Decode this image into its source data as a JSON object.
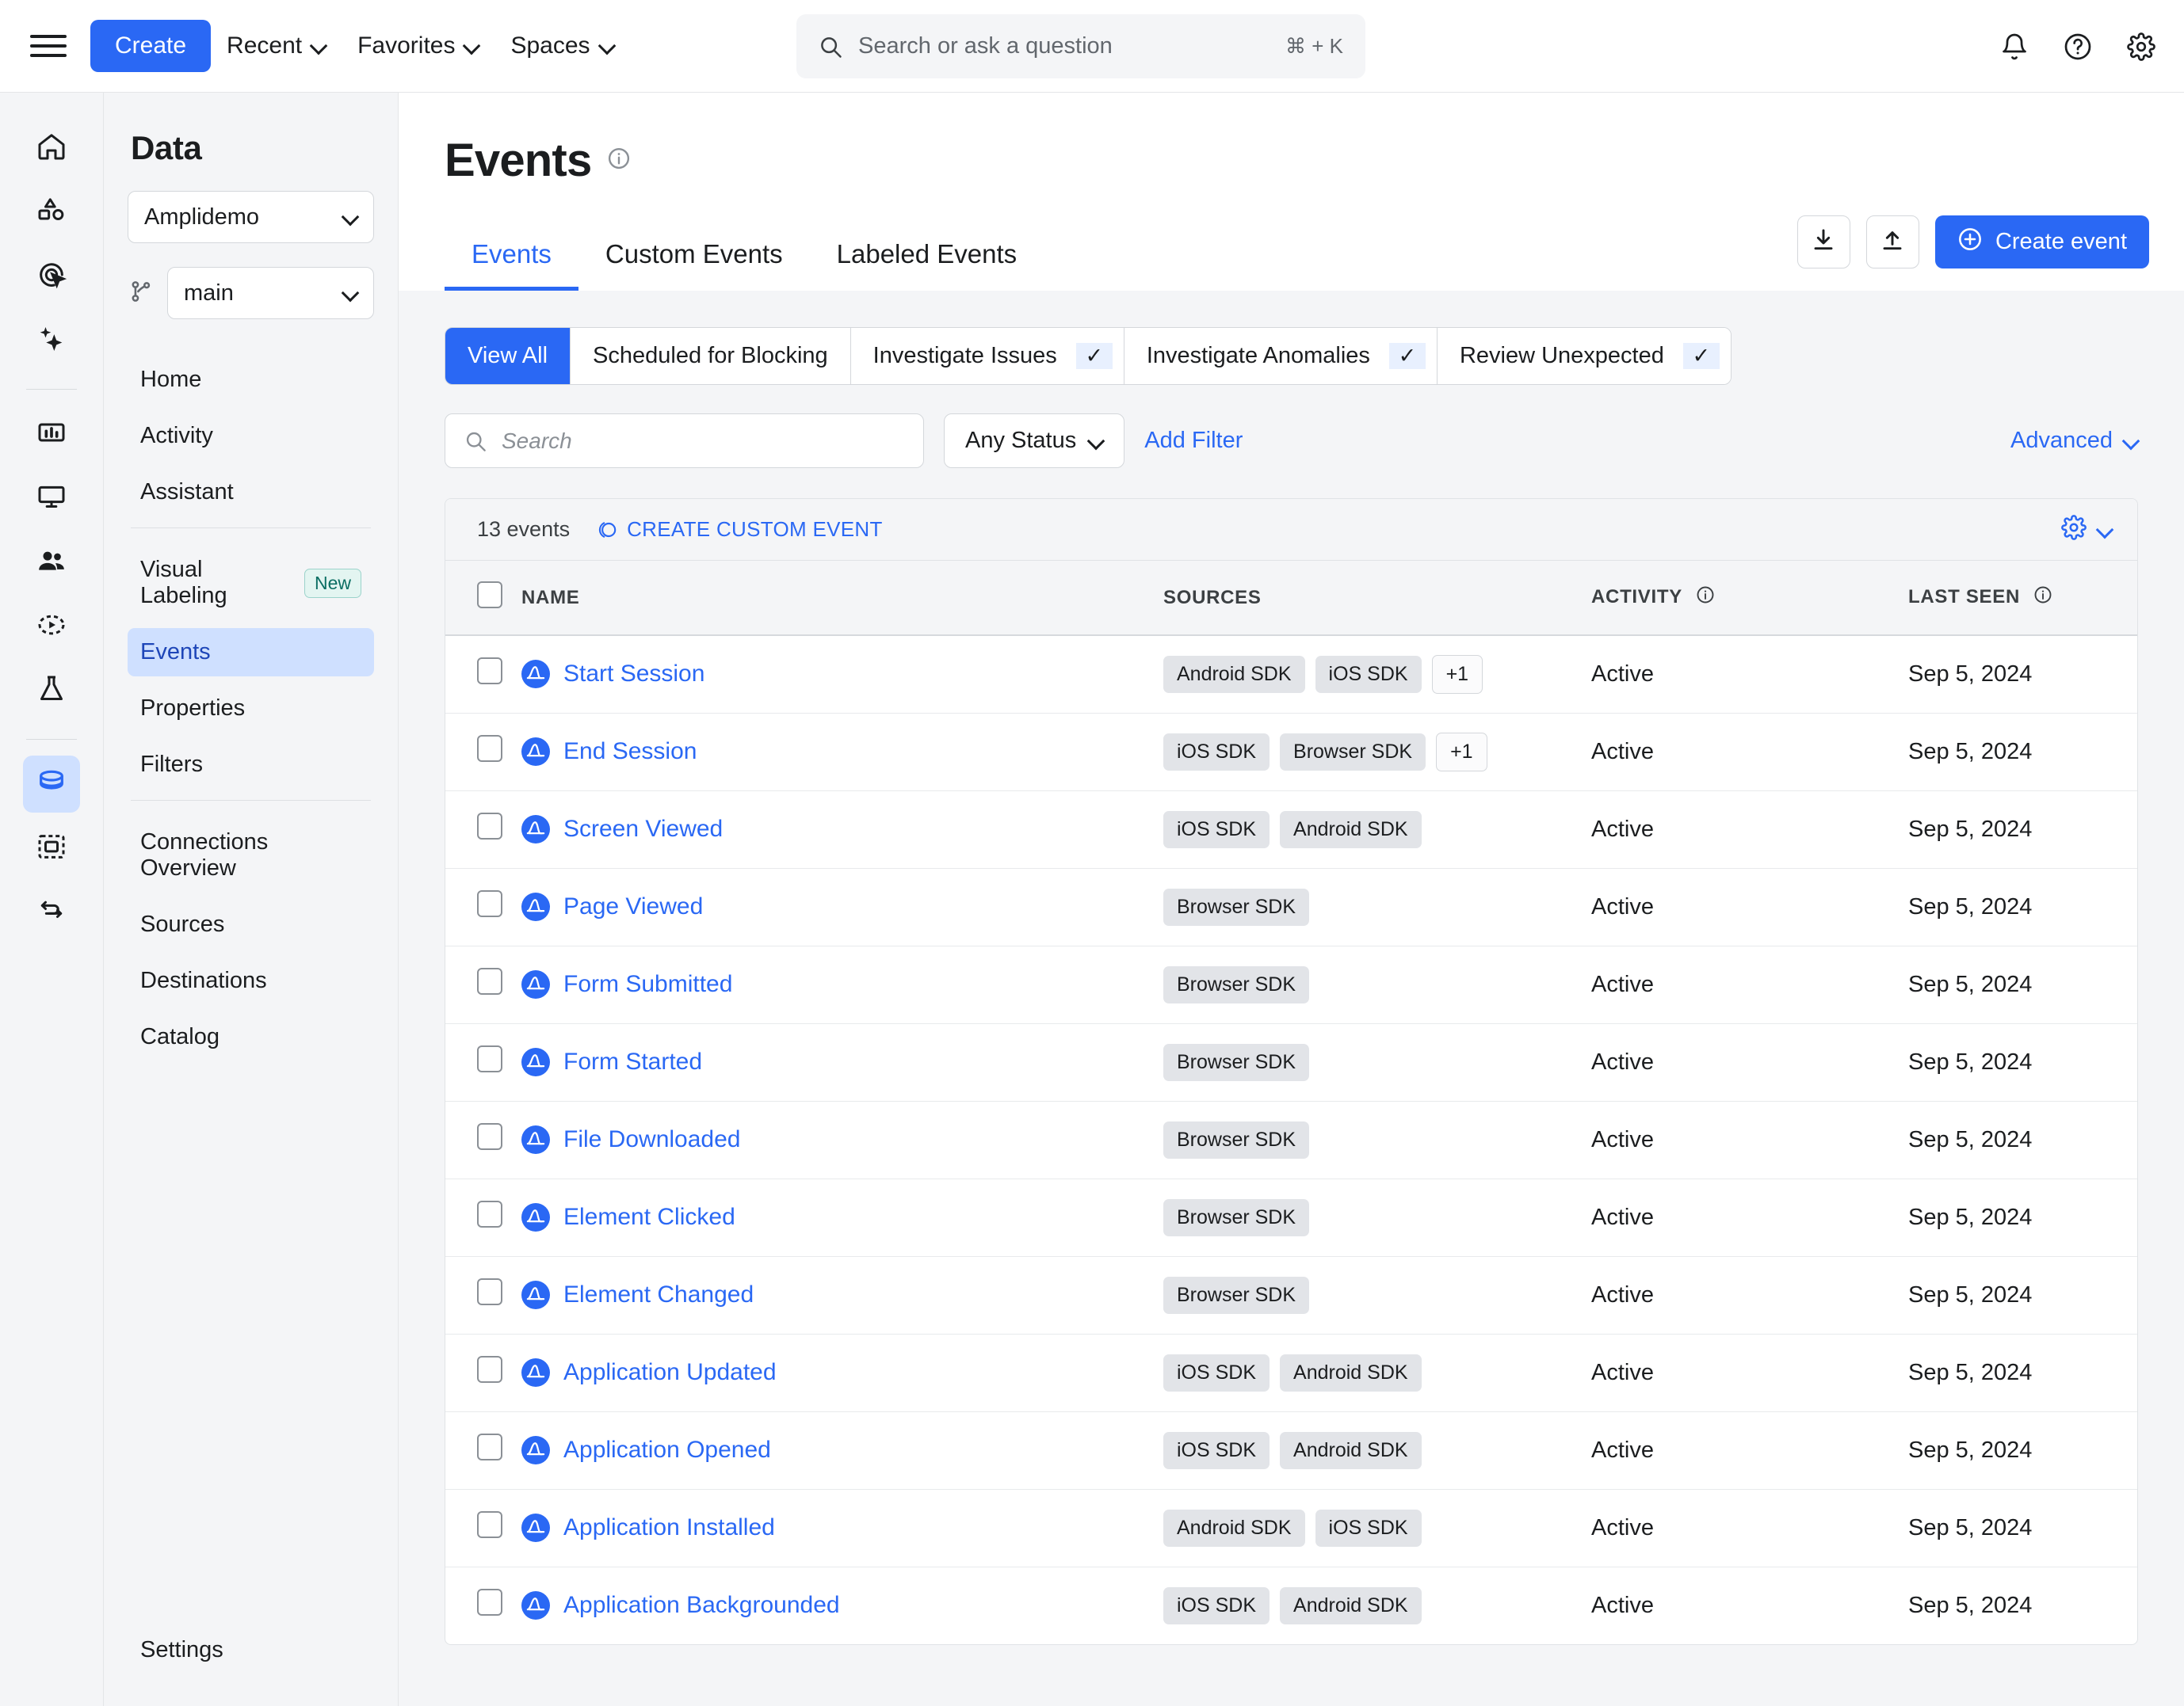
{
  "topbar": {
    "create_label": "Create",
    "nav": [
      {
        "label": "Recent"
      },
      {
        "label": "Favorites"
      },
      {
        "label": "Spaces"
      }
    ],
    "search_placeholder": "Search or ask a question",
    "search_value": "",
    "search_shortcut": "⌘ + K",
    "icons": [
      "bell-icon",
      "help-icon",
      "settings-icon"
    ]
  },
  "rail": {
    "items": [
      {
        "name": "home-icon"
      },
      {
        "name": "shapes-icon"
      },
      {
        "name": "target-click-icon"
      },
      {
        "name": "sparkles-icon"
      },
      {
        "name": "chart-icon"
      },
      {
        "name": "monitor-icon"
      },
      {
        "name": "people-icon"
      },
      {
        "name": "session-replay-icon"
      },
      {
        "name": "experiment-icon"
      },
      {
        "name": "data-icon"
      },
      {
        "name": "guides-surveys-icon"
      },
      {
        "name": "flow-icon"
      }
    ],
    "active": "data-icon"
  },
  "sidebar": {
    "title": "Data",
    "project_select": "Amplidemo",
    "branch_select": "main",
    "items": [
      {
        "label": "Home",
        "active": false
      },
      {
        "label": "Activity",
        "active": false
      },
      {
        "label": "Assistant",
        "active": false
      },
      {
        "label": "Visual Labeling",
        "active": false,
        "badge": "New"
      },
      {
        "label": "Events",
        "active": true
      },
      {
        "label": "Properties",
        "active": false
      },
      {
        "label": "Filters",
        "active": false
      },
      {
        "label": "Connections Overview",
        "active": false
      },
      {
        "label": "Sources",
        "active": false
      },
      {
        "label": "Destinations",
        "active": false
      },
      {
        "label": "Catalog",
        "active": false
      }
    ],
    "settings_label": "Settings"
  },
  "main": {
    "page_title": "Events",
    "download_icon": "download-icon",
    "upload_icon": "upload-icon",
    "create_event_label": "Create event",
    "tabs": [
      {
        "label": "Events",
        "active": true
      },
      {
        "label": "Custom Events",
        "active": false
      },
      {
        "label": "Labeled Events",
        "active": false
      }
    ],
    "segments": [
      {
        "label": "View All",
        "active": true,
        "check": false
      },
      {
        "label": "Scheduled for Blocking",
        "active": false,
        "check": false
      },
      {
        "label": "Investigate Issues",
        "active": false,
        "check": true
      },
      {
        "label": "Investigate Anomalies",
        "active": false,
        "check": true
      },
      {
        "label": "Review Unexpected",
        "active": false,
        "check": true
      }
    ],
    "search_placeholder": "Search",
    "search_value": "",
    "status_filter": "Any Status",
    "add_filter_label": "Add Filter",
    "advanced_label": "Advanced",
    "count_label": "13 events",
    "create_custom_event_label": "CREATE CUSTOM EVENT",
    "columns": [
      "NAME",
      "SOURCES",
      "ACTIVITY",
      "LAST SEEN"
    ],
    "rows": [
      {
        "name": "Start Session",
        "sources": [
          "Android SDK",
          "iOS SDK"
        ],
        "more": "+1",
        "activity": "Active",
        "last_seen": "Sep 5, 2024"
      },
      {
        "name": "End Session",
        "sources": [
          "iOS SDK",
          "Browser SDK"
        ],
        "more": "+1",
        "activity": "Active",
        "last_seen": "Sep 5, 2024"
      },
      {
        "name": "Screen Viewed",
        "sources": [
          "iOS SDK",
          "Android SDK"
        ],
        "more": "",
        "activity": "Active",
        "last_seen": "Sep 5, 2024"
      },
      {
        "name": "Page Viewed",
        "sources": [
          "Browser SDK"
        ],
        "more": "",
        "activity": "Active",
        "last_seen": "Sep 5, 2024"
      },
      {
        "name": "Form Submitted",
        "sources": [
          "Browser SDK"
        ],
        "more": "",
        "activity": "Active",
        "last_seen": "Sep 5, 2024"
      },
      {
        "name": "Form Started",
        "sources": [
          "Browser SDK"
        ],
        "more": "",
        "activity": "Active",
        "last_seen": "Sep 5, 2024"
      },
      {
        "name": "File Downloaded",
        "sources": [
          "Browser SDK"
        ],
        "more": "",
        "activity": "Active",
        "last_seen": "Sep 5, 2024"
      },
      {
        "name": "Element Clicked",
        "sources": [
          "Browser SDK"
        ],
        "more": "",
        "activity": "Active",
        "last_seen": "Sep 5, 2024"
      },
      {
        "name": "Element Changed",
        "sources": [
          "Browser SDK"
        ],
        "more": "",
        "activity": "Active",
        "last_seen": "Sep 5, 2024"
      },
      {
        "name": "Application Updated",
        "sources": [
          "iOS SDK",
          "Android SDK"
        ],
        "more": "",
        "activity": "Active",
        "last_seen": "Sep 5, 2024"
      },
      {
        "name": "Application Opened",
        "sources": [
          "iOS SDK",
          "Android SDK"
        ],
        "more": "",
        "activity": "Active",
        "last_seen": "Sep 5, 2024"
      },
      {
        "name": "Application Installed",
        "sources": [
          "Android SDK",
          "iOS SDK"
        ],
        "more": "",
        "activity": "Active",
        "last_seen": "Sep 5, 2024"
      },
      {
        "name": "Application Backgrounded",
        "sources": [
          "iOS SDK",
          "Android SDK"
        ],
        "more": "",
        "activity": "Active",
        "last_seen": "Sep 5, 2024"
      }
    ]
  },
  "colors": {
    "accent": "#2a68f4",
    "panel_bg": "#f4f5f7",
    "badge_new_text": "#0b6e63",
    "tag_bg": "#e2e4e8"
  }
}
